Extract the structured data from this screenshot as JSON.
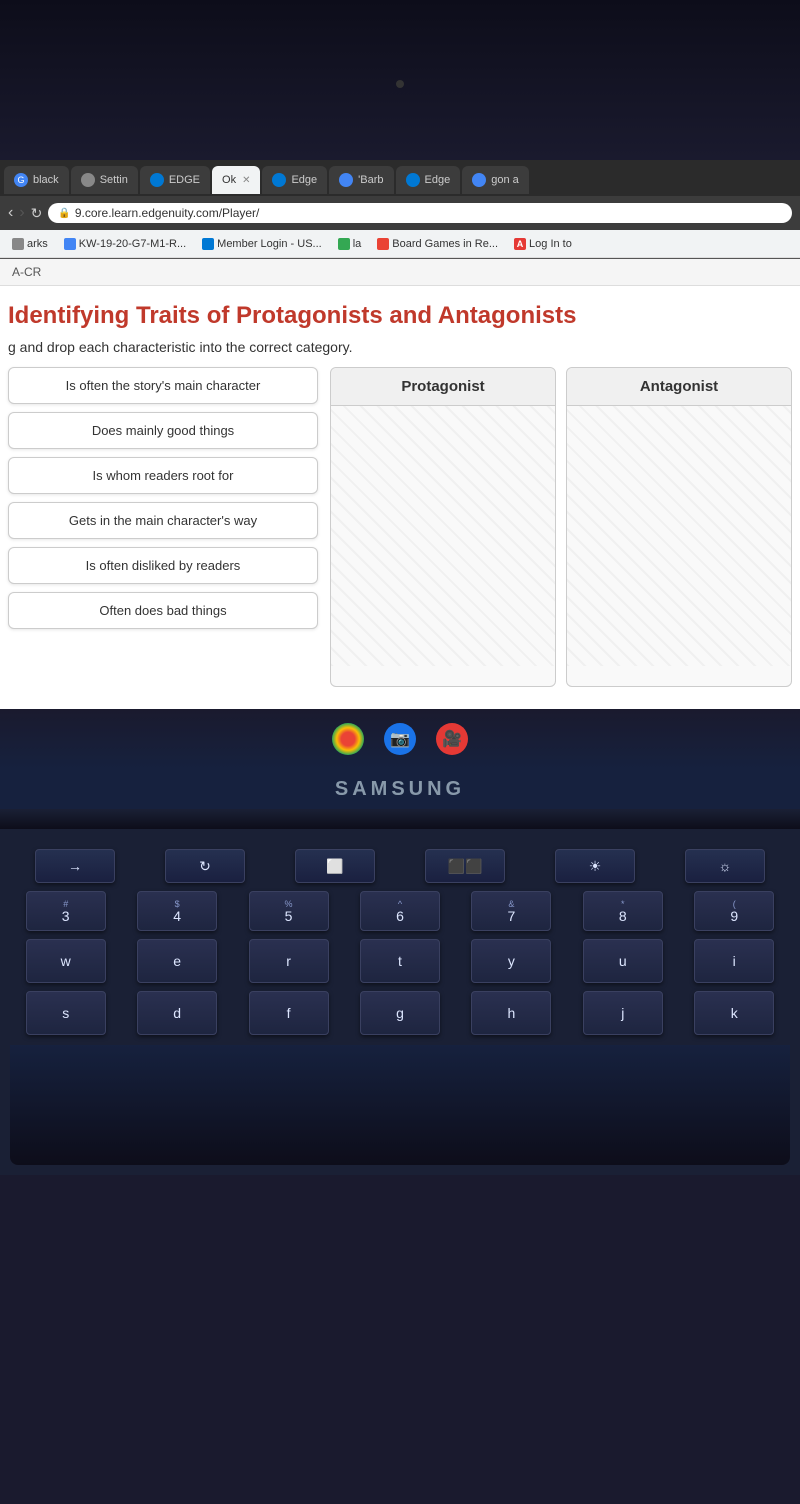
{
  "browser": {
    "tabs": [
      {
        "label": "black",
        "icon_color": "#4285f4",
        "active": false,
        "icon": "G"
      },
      {
        "label": "Settin",
        "icon_color": "#888",
        "active": false,
        "icon": "⚙"
      },
      {
        "label": "EDGE",
        "icon_color": "#0078d4",
        "active": false,
        "icon": "E"
      },
      {
        "label": "Ok",
        "icon_color": "#888",
        "active": true,
        "icon": ""
      },
      {
        "label": "Edge",
        "icon_color": "#0078d4",
        "active": false,
        "icon": "E"
      },
      {
        "label": "'Barb",
        "icon_color": "#4285f4",
        "active": false,
        "icon": "G"
      },
      {
        "label": "Edge",
        "icon_color": "#0078d4",
        "active": false,
        "icon": "E"
      },
      {
        "label": "gon a",
        "icon_color": "#4285f4",
        "active": false,
        "icon": "G"
      }
    ],
    "address": "9.core.learn.edgenuity.com/Player/",
    "bookmarks": [
      {
        "label": "arks",
        "icon": "★"
      },
      {
        "label": "KW-19-20-G7-M1-R...",
        "icon": "★"
      },
      {
        "label": "Member Login - US...",
        "icon": "★"
      },
      {
        "label": "la",
        "icon": "⊕"
      },
      {
        "label": "Board Games in Re...",
        "icon": "🎮"
      },
      {
        "label": "Log In to",
        "icon": "A"
      }
    ]
  },
  "page": {
    "breadcrumb": "A-CR",
    "title": "Identifying Traits of Protagonists and Antagonists",
    "instructions": "g and drop each characteristic into the correct category.",
    "characteristics": [
      {
        "id": "char1",
        "text": "Is often the story's main character"
      },
      {
        "id": "char2",
        "text": "Does mainly good things"
      },
      {
        "id": "char3",
        "text": "Is whom readers root for"
      },
      {
        "id": "char4",
        "text": "Gets in the main character's way"
      },
      {
        "id": "char5",
        "text": "Is often disliked by readers"
      },
      {
        "id": "char6",
        "text": "Often does bad things"
      }
    ],
    "drop_zones": [
      {
        "label": "Protagonist",
        "items": []
      },
      {
        "label": "Antagonist",
        "items": []
      }
    ]
  },
  "samsung": {
    "label": "SAMSUNG"
  },
  "keyboard": {
    "row1": [
      {
        "top": "→",
        "main": ""
      },
      {
        "top": "C",
        "main": ""
      },
      {
        "top": "⬜",
        "main": ""
      },
      {
        "top": "⬛⬛",
        "main": ""
      },
      {
        "top": "⚙",
        "main": ""
      },
      {
        "top": "⚙",
        "main": ""
      }
    ],
    "row2": [
      {
        "top": "#",
        "main": "3"
      },
      {
        "top": "$",
        "main": "4"
      },
      {
        "top": "%",
        "main": "5"
      },
      {
        "top": "^",
        "main": "6"
      },
      {
        "top": "&",
        "main": "7"
      },
      {
        "top": "*",
        "main": "8"
      },
      {
        "top": "(",
        "main": "9"
      }
    ],
    "row3": [
      {
        "top": "",
        "main": "w"
      },
      {
        "top": "",
        "main": "e"
      },
      {
        "top": "",
        "main": "r"
      },
      {
        "top": "",
        "main": "t"
      },
      {
        "top": "",
        "main": "y"
      },
      {
        "top": "",
        "main": "u"
      },
      {
        "top": "",
        "main": "i"
      }
    ],
    "row4": [
      {
        "top": "",
        "main": "s"
      },
      {
        "top": "",
        "main": "d"
      },
      {
        "top": "",
        "main": "f"
      },
      {
        "top": "",
        "main": "g"
      },
      {
        "top": "",
        "main": "h"
      },
      {
        "top": "",
        "main": "j"
      },
      {
        "top": "",
        "main": "k"
      }
    ]
  },
  "taskbar_icons": [
    {
      "color": "#ea4335",
      "label": "chrome"
    },
    {
      "color": "#1a73e8",
      "label": "camera"
    },
    {
      "color": "#e53935",
      "label": "video"
    }
  ]
}
